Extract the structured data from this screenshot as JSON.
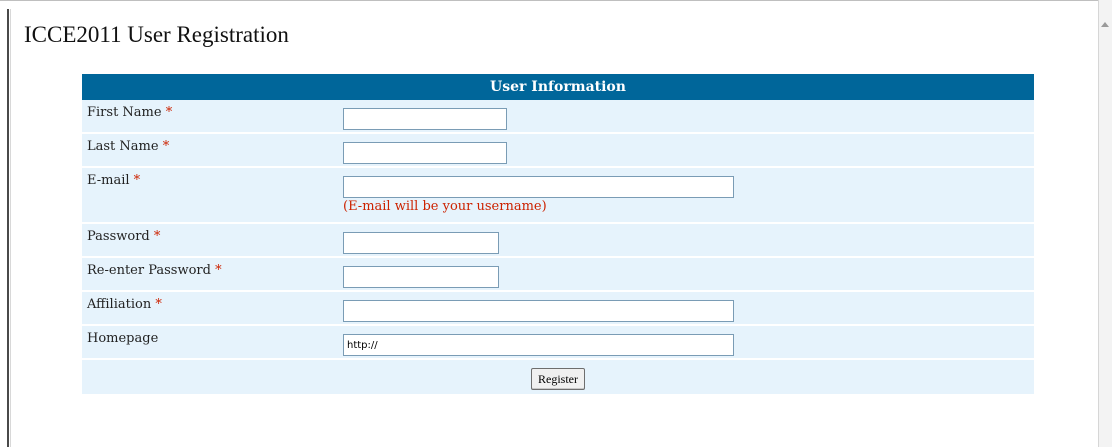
{
  "page": {
    "title": "ICCE2011 User Registration"
  },
  "form": {
    "header": "User Information",
    "required_marker": "*",
    "fields": {
      "first_name": {
        "label": "First Name",
        "value": ""
      },
      "last_name": {
        "label": "Last Name",
        "value": ""
      },
      "email": {
        "label": "E-mail",
        "value": "",
        "note": "(E-mail will be your username)"
      },
      "password": {
        "label": "Password",
        "value": ""
      },
      "reenter_password": {
        "label": "Re-enter Password",
        "value": ""
      },
      "affiliation": {
        "label": "Affiliation",
        "value": ""
      },
      "homepage": {
        "label": "Homepage",
        "value": "http://"
      }
    },
    "submit_label": "Register"
  },
  "colors": {
    "header_bg": "#00669a",
    "row_bg": "#e6f3fc",
    "required": "#cc2200"
  }
}
